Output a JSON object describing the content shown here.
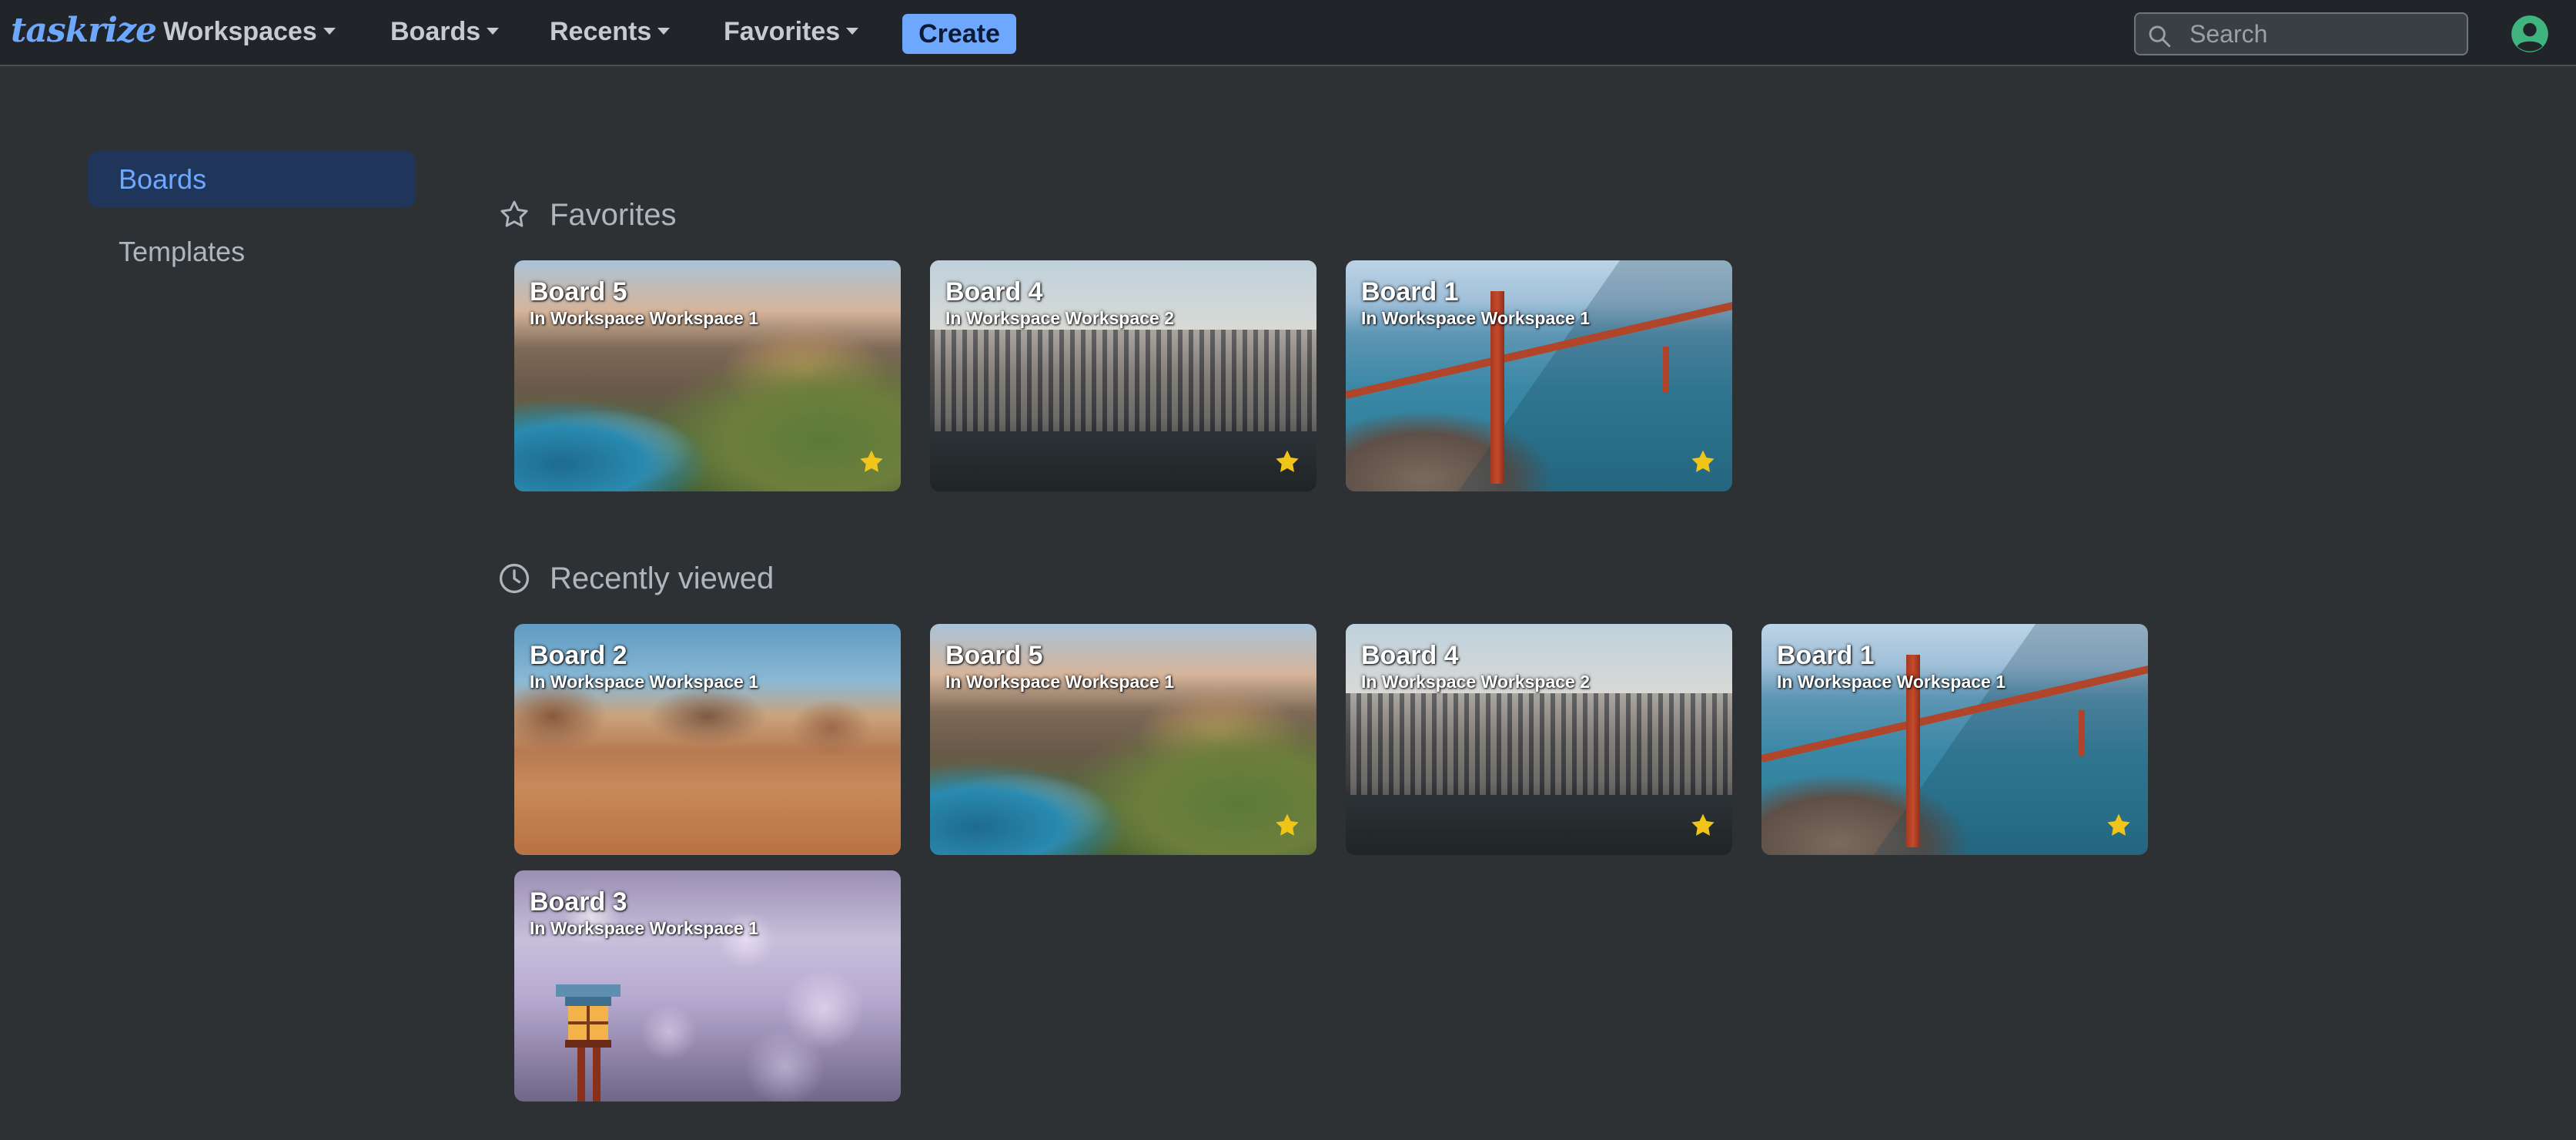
{
  "app": {
    "brand": "taskrize"
  },
  "navbar": {
    "menus": [
      {
        "label": "Workspaces"
      },
      {
        "label": "Boards"
      },
      {
        "label": "Recents"
      },
      {
        "label": "Favorites"
      }
    ],
    "create_label": "Create",
    "search_placeholder": "Search",
    "icons": {
      "search": "search-icon",
      "avatar": "user-avatar-icon"
    }
  },
  "sidebar": {
    "items": [
      {
        "label": "Boards",
        "active": true
      },
      {
        "label": "Templates",
        "active": false
      }
    ]
  },
  "sections": {
    "favorites": {
      "title": "Favorites",
      "icon": "star-outline-icon",
      "boards": [
        {
          "title": "Board 5",
          "workspace": "In Workspace Workspace 1",
          "starred": true,
          "image": "coastal-bridge"
        },
        {
          "title": "Board 4",
          "workspace": "In Workspace Workspace 2",
          "starred": true,
          "image": "city-skyline"
        },
        {
          "title": "Board 1",
          "workspace": "In Workspace Workspace 1",
          "starred": true,
          "image": "golden-gate-bridge"
        }
      ]
    },
    "recent": {
      "title": "Recently viewed",
      "icon": "clock-icon",
      "boards": [
        {
          "title": "Board 2",
          "workspace": "In Workspace Workspace 1",
          "starred": false,
          "image": "desert-canyon"
        },
        {
          "title": "Board 5",
          "workspace": "In Workspace Workspace 1",
          "starred": true,
          "image": "coastal-bridge"
        },
        {
          "title": "Board 4",
          "workspace": "In Workspace Workspace 2",
          "starred": true,
          "image": "city-skyline"
        },
        {
          "title": "Board 1",
          "workspace": "In Workspace Workspace 1",
          "starred": true,
          "image": "golden-gate-bridge"
        },
        {
          "title": "Board 3",
          "workspace": "In Workspace Workspace 1",
          "starred": false,
          "image": "cherry-blossom-lantern"
        }
      ]
    }
  },
  "colors": {
    "accent": "#6ea8fe",
    "background": "#2e3134",
    "navbar": "#212529",
    "star": "#f0c419",
    "avatar": "#3fb47e"
  }
}
